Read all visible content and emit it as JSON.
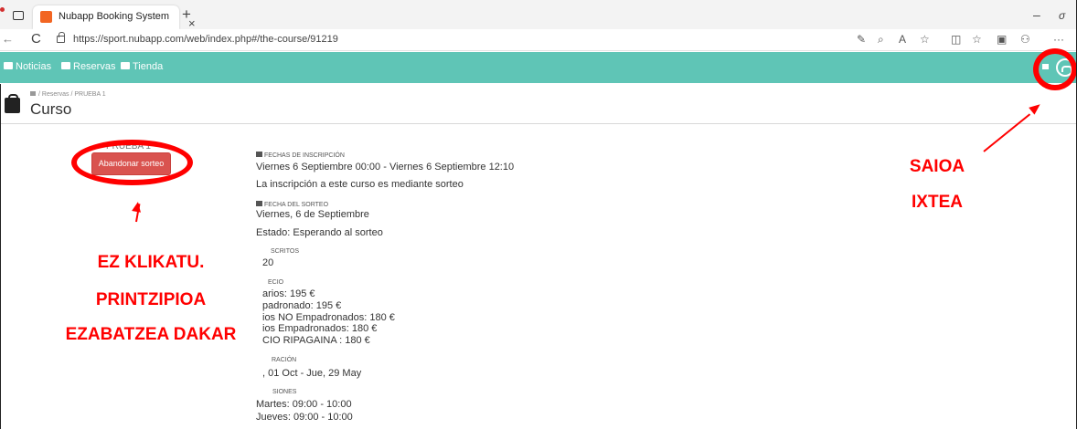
{
  "browser": {
    "tab_title": "Nubapp Booking System",
    "tab_close": "×",
    "new_tab": "+",
    "url": "https://sport.nubapp.com/web/index.php#/the-course/91219",
    "back": "←",
    "reload": "C",
    "win_min": "–",
    "win_restore": "σ",
    "more": "···"
  },
  "navbar": {
    "items": [
      {
        "label": "Noticias"
      },
      {
        "label": "Reservas"
      },
      {
        "label": "Tienda"
      }
    ],
    "accent_color": "#5fc5b6"
  },
  "header": {
    "breadcrumb": [
      "Reservas",
      "PRUEBA 1"
    ],
    "breadcrumb_sep": "/",
    "title": "Curso"
  },
  "course": {
    "name": "PRUEBA 1",
    "abandon_button": "Abandonar sorteo",
    "button_color": "#d9534f"
  },
  "details": {
    "inscription_label": "FECHAS DE INSCRIPCIÓN",
    "inscription_value": "Viernes 6 Septiembre 00:00 - Viernes 6 Septiembre 12:10",
    "draw_note": "La inscripción a este curso es mediante sorteo",
    "draw_date_label": "FECHA DEL SORTEO",
    "draw_date_value": "Viernes, 6 de Septiembre",
    "state": "Estado: Esperando al sorteo",
    "enrolled_label": "SCRITOS",
    "enrolled_value": "20",
    "price_label": "ECIO",
    "prices": [
      "arios: 195 €",
      "padronado: 195 €",
      "ios NO Empadronados: 180 €",
      "ios Empadronados: 180 €",
      "CIO RIPAGAINA : 180 €"
    ],
    "duration_label": "RACIÓN",
    "duration_value": ", 01 Oct - Jue, 29 May",
    "sessions_label": "SIONES",
    "sessions": [
      "Martes: 09:00 - 10:00",
      "Jueves: 09:00 - 10:00"
    ]
  },
  "annotations": {
    "left_text": [
      "EZ KLIKATU.",
      "PRINTZIPIOA",
      "EZABATZEA DAKAR"
    ],
    "right_text": [
      "SAIOA",
      "IXTEA"
    ],
    "color": "#ff0000"
  }
}
